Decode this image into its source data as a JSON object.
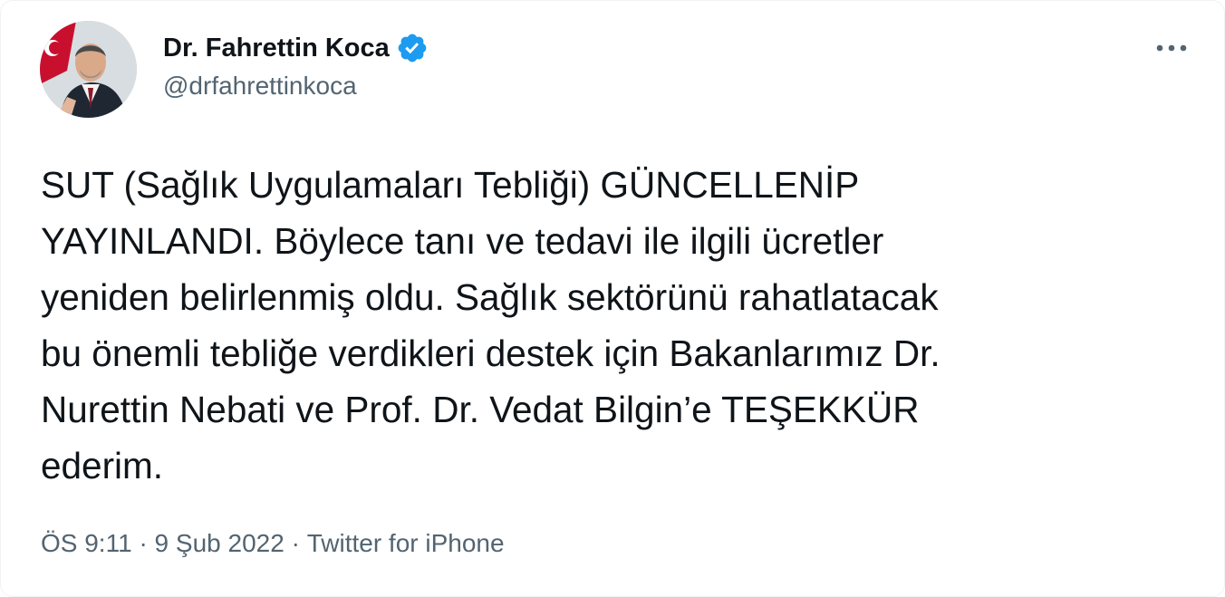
{
  "author": {
    "display_name": "Dr. Fahrettin Koca",
    "handle": "@drfahrettinkoca",
    "verified": true,
    "avatar_icon": "profile-photo"
  },
  "more_icon": "more-horizontal-icon",
  "tweet": {
    "text": "SUT (Sağlık Uygulamaları Tebliği) GÜNCELLENİP\nYAYINLANDI. Böylece tanı ve tedavi ile ilgili ücretler\nyeniden belirlenmiş oldu. Sağlık sektörünü rahatlatacak\nbu önemli tebliğe verdikleri destek için Bakanlarımız Dr.\nNurettin Nebati ve Prof. Dr. Vedat Bilgin’e TEŞEKKÜR\nederim."
  },
  "meta": {
    "time": "ÖS 9:11",
    "separator": "·",
    "date": "9 Şub 2022",
    "source": "Twitter for iPhone"
  },
  "colors": {
    "verified_blue": "#1d9bf0",
    "secondary_text": "#536471",
    "primary_text": "#0f1419"
  }
}
